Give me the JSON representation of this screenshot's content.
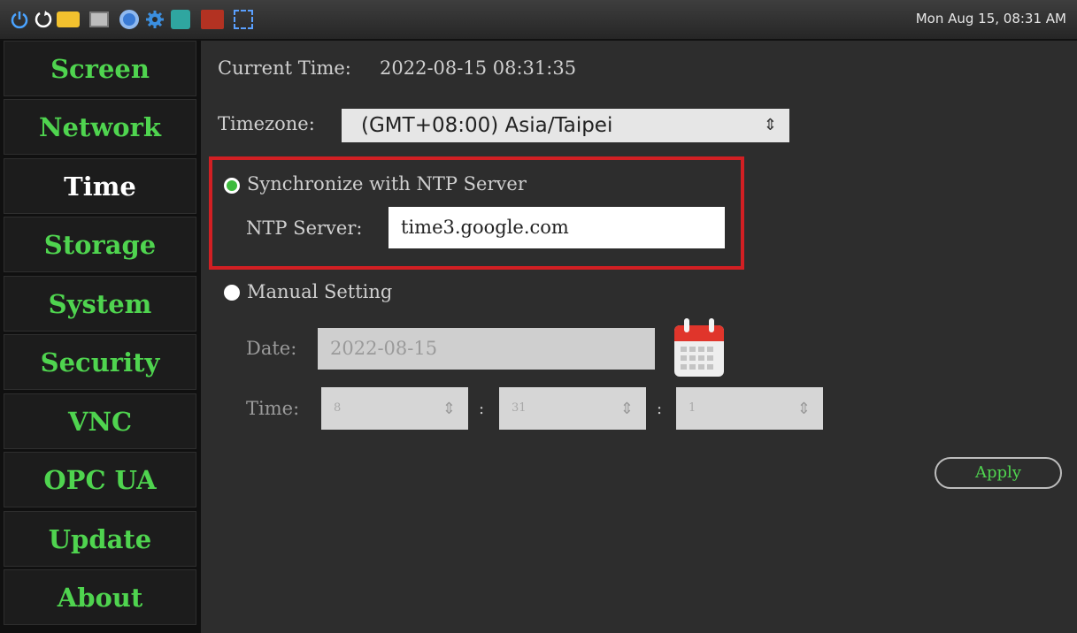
{
  "taskbar": {
    "icons": [
      "power-icon",
      "restart-icon",
      "nxp-app-icon",
      "terminal-icon",
      "chromium-icon",
      "settings-gear-icon",
      "search-app-icon",
      "tightvnc-icon",
      "screenshot-select-icon"
    ],
    "clock": "Mon Aug 15, 08:31 AM"
  },
  "sidebar": {
    "items": [
      {
        "label": "Screen"
      },
      {
        "label": "Network"
      },
      {
        "label": "Time",
        "active": true
      },
      {
        "label": "Storage"
      },
      {
        "label": "System"
      },
      {
        "label": "Security"
      },
      {
        "label": "VNC"
      },
      {
        "label": "OPC UA"
      },
      {
        "label": "Update"
      },
      {
        "label": "About"
      }
    ]
  },
  "main": {
    "current_time_label": "Current Time:",
    "current_time_value": "2022-08-15  08:31:35",
    "timezone_label": "Timezone:",
    "timezone_value": "(GMT+08:00) Asia/Taipei",
    "ntp": {
      "option_label": "Synchronize with NTP Server",
      "selected": true,
      "server_label": "NTP Server:",
      "server_value": "time3.google.com"
    },
    "manual": {
      "option_label": "Manual Setting",
      "selected": false,
      "date_label": "Date:",
      "date_value": "2022-08-15",
      "time_label": "Time:",
      "hour": "8",
      "minute": "31",
      "second": "1",
      "separator": ":"
    },
    "apply_label": "Apply"
  },
  "colors": {
    "accent_green": "#4fd44f",
    "highlight_red": "#d21f23",
    "panel_bg": "#2d2d2d"
  }
}
